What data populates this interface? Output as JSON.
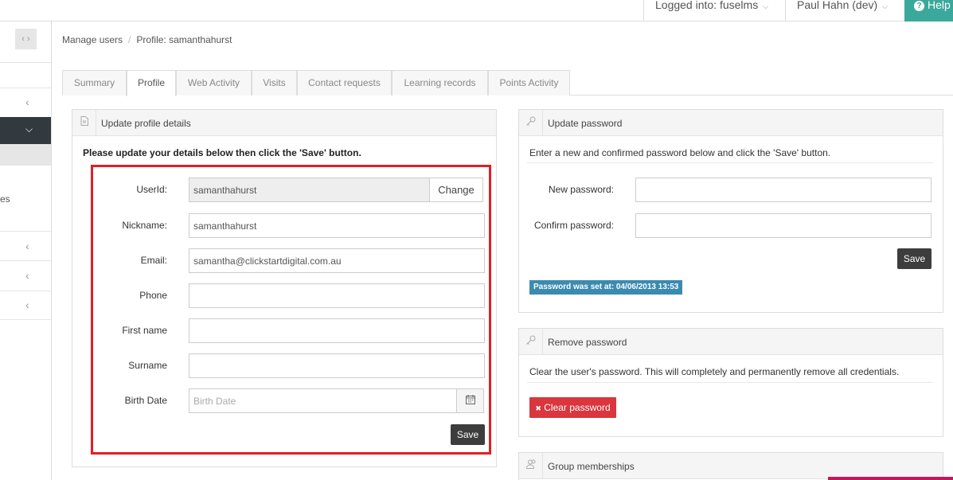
{
  "topbar": {
    "logged_into": "Logged into: fuselms",
    "user": "Paul Hahn (dev)",
    "help": "Help",
    "caret": "⌵",
    "help_icon": "?"
  },
  "sidebar": {
    "collapse_icon": "‹ ›",
    "chevron_left": "‹",
    "chevron_down": "⌵",
    "item_fragment": "es"
  },
  "breadcrumb": {
    "items": [
      "Manage users",
      "Profile: samanthahurst"
    ],
    "separator": "/"
  },
  "tabs": [
    {
      "label": "Summary"
    },
    {
      "label": "Profile",
      "active": true
    },
    {
      "label": "Web Activity"
    },
    {
      "label": "Visits"
    },
    {
      "label": "Contact requests"
    },
    {
      "label": "Learning records"
    },
    {
      "label": "Points Activity"
    }
  ],
  "profile_panel": {
    "title": "Update profile details",
    "icon": "document-icon",
    "instructions": "Please update your details below then click the 'Save' button.",
    "fields": {
      "userid": {
        "label": "UserId:",
        "value": "samanthahurst",
        "button": "Change"
      },
      "nickname": {
        "label": "Nickname:",
        "value": "samanthahurst"
      },
      "email": {
        "label": "Email:",
        "value": "samantha@clickstartdigital.com.au"
      },
      "phone": {
        "label": "Phone",
        "value": ""
      },
      "first_name": {
        "label": "First name",
        "value": ""
      },
      "surname": {
        "label": "Surname",
        "value": ""
      },
      "birth_date": {
        "label": "Birth Date",
        "value": "",
        "placeholder": "Birth Date"
      }
    },
    "save_label": "Save"
  },
  "password_panel": {
    "title": "Update password",
    "icon": "key-icon",
    "instructions": "Enter a new and confirmed password below and click the 'Save' button.",
    "new_label": "New password:",
    "confirm_label": "Confirm password:",
    "save_label": "Save",
    "badge": "Password was set at: 04/06/2013 13:53"
  },
  "remove_panel": {
    "title": "Remove password",
    "icon": "key-icon",
    "description": "Clear the user's password. This will completely and permanently remove all credentials.",
    "button_label": "Clear password",
    "button_icon": "✖"
  },
  "groups_panel": {
    "title": "Group memberships",
    "icon": "users-icon"
  },
  "colors": {
    "highlight": "#e01f26",
    "help_bg": "#3aa89a",
    "danger": "#d9363e",
    "badge": "#3b8bb0",
    "sidebar_active": "#333a3f"
  }
}
